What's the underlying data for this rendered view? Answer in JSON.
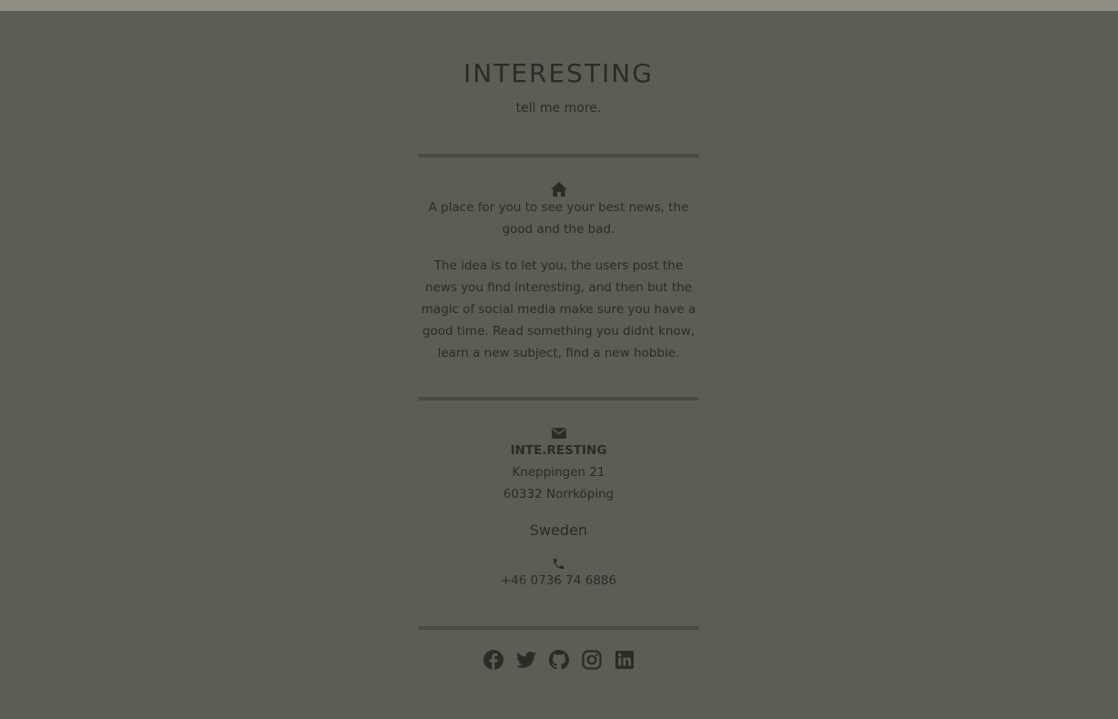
{
  "header": {
    "title": "INTERESTING",
    "subtitle": "tell me more."
  },
  "about": {
    "icon": "home-icon",
    "paragraph1": "A place for you to see your best news, the good and the bad.",
    "paragraph2": "The idea is to let you, the users post the news you find interesting, and then but the magic of social media make sure you have a good time. Read something you didnt know, learn a new subject, find a new hobbie."
  },
  "contact": {
    "mail_icon": "envelope-icon",
    "company": "INTE.RESTING",
    "street": "Kneppingen 21",
    "city": "60332 Norrköping",
    "country": "Sweden",
    "phone_icon": "phone-icon",
    "phone": "+46 0736 74 6886"
  },
  "socials": [
    {
      "icon": "facebook-icon"
    },
    {
      "icon": "twitter-icon"
    },
    {
      "icon": "github-icon"
    },
    {
      "icon": "instagram-icon"
    },
    {
      "icon": "linkedin-icon"
    }
  ],
  "colors": {
    "background": "#5c5d55",
    "topbar": "#8f8f86",
    "text": "#2b2c28",
    "divider": "#4a4b44"
  }
}
